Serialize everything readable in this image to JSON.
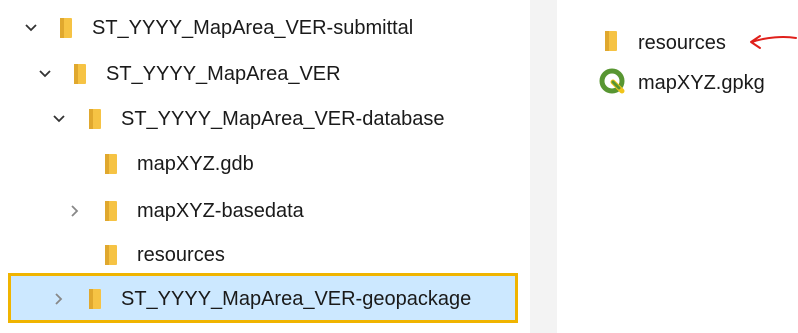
{
  "tree": {
    "items": [
      {
        "label": "ST_YYYY_MapArea_VER-submittal",
        "state": "expanded"
      },
      {
        "label": "ST_YYYY_MapArea_VER",
        "state": "expanded"
      },
      {
        "label": "ST_YYYY_MapArea_VER-database",
        "state": "expanded"
      },
      {
        "label": "mapXYZ.gdb",
        "state": "leaf"
      },
      {
        "label": "mapXYZ-basedata",
        "state": "collapsed"
      },
      {
        "label": "resources",
        "state": "leaf"
      },
      {
        "label": "ST_YYYY_MapArea_VER-geopackage",
        "state": "collapsed",
        "selected": true
      }
    ]
  },
  "content": {
    "items": [
      {
        "label": "resources",
        "type": "folder"
      },
      {
        "label": "mapXYZ.gpkg",
        "type": "qgis-geopackage"
      }
    ]
  },
  "colors": {
    "folder": "#f6c344",
    "folder_shade": "#e0a82e",
    "selection_fill": "#cce8ff",
    "selection_border": "#f0b400",
    "annotation_arrow": "#e0201b",
    "qgis_green": "#589632",
    "qgis_yellow": "#f0c419"
  }
}
